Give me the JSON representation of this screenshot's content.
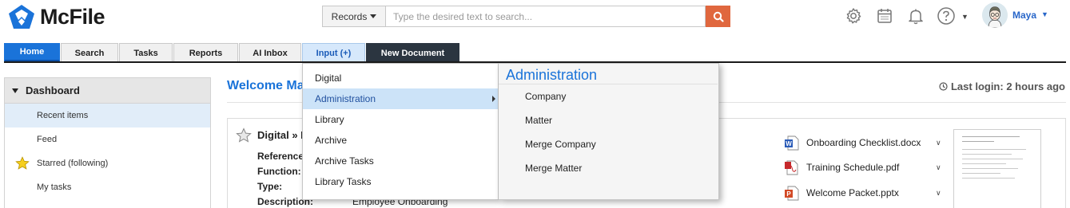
{
  "header": {
    "logo_text": "McFile",
    "search": {
      "scope_label": "Records",
      "placeholder": "Type the desired text to search..."
    },
    "user": {
      "name": "Maya"
    },
    "icons": [
      "gear-icon",
      "calendar-icon",
      "bell-icon",
      "help-icon",
      "search-icon"
    ]
  },
  "nav": {
    "tabs": [
      {
        "label": "Home"
      },
      {
        "label": "Search"
      },
      {
        "label": "Tasks"
      },
      {
        "label": "Reports"
      },
      {
        "label": "AI Inbox"
      },
      {
        "label": "Input (+)"
      },
      {
        "label": "New Document"
      }
    ]
  },
  "sidebar": {
    "heading": "Dashboard",
    "items": [
      {
        "label": "Recent items"
      },
      {
        "label": "Feed"
      },
      {
        "label": "Starred (following)"
      },
      {
        "label": "My tasks"
      }
    ]
  },
  "main": {
    "welcome": "Welcome Ma",
    "last_login": "Last login: 2 hours ago",
    "card": {
      "title": "Digital » I",
      "fields": [
        {
          "label": "Reference"
        },
        {
          "label": "Function:"
        },
        {
          "label": "Type:"
        },
        {
          "label": "Description:",
          "value": "Employee Onboarding"
        }
      ],
      "files": [
        {
          "name": "Onboarding Checklist.docx",
          "type": "word"
        },
        {
          "name": "Training Schedule.pdf",
          "type": "pdf"
        },
        {
          "name": "Welcome Packet.pptx",
          "type": "powerpoint"
        }
      ]
    }
  },
  "dropdown": {
    "items": [
      {
        "label": "Digital"
      },
      {
        "label": "Administration"
      },
      {
        "label": "Library"
      },
      {
        "label": "Archive"
      },
      {
        "label": "Archive Tasks"
      },
      {
        "label": "Library Tasks"
      }
    ],
    "submenu": {
      "title": "Administration",
      "items": [
        {
          "label": "Company"
        },
        {
          "label": "Matter"
        },
        {
          "label": "Merge Company"
        },
        {
          "label": "Merge Matter"
        }
      ]
    }
  },
  "colors": {
    "brand_blue": "#1a73d9",
    "search_button": "#e0673e",
    "new_document_tab": "#2b3540",
    "active_menu_item": "#cce3f8"
  }
}
